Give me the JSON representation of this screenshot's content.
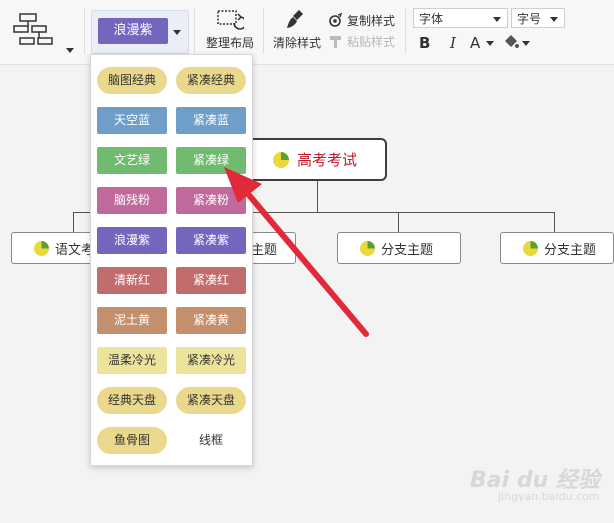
{
  "toolbar": {
    "theme_label": "浪漫紫",
    "tidy_layout": "整理布局",
    "clear_style": "清除样式",
    "copy_style": "复制样式",
    "paste_style": "粘贴样式",
    "font_placeholder": "字体",
    "size_placeholder": "字号",
    "bold": "B",
    "italic": "I",
    "font_color": "A"
  },
  "mindmap": {
    "root": "高考考试",
    "branches": [
      "语文考",
      "主题",
      "分支主题",
      "分支主题"
    ]
  },
  "theme_options": [
    {
      "label": "脑图经典",
      "bg": "#ead98c",
      "fg": "#333333",
      "pill": true
    },
    {
      "label": "紧凑经典",
      "bg": "#ead98c",
      "fg": "#333333",
      "pill": true
    },
    {
      "label": "天空蓝",
      "bg": "#6f9ec8",
      "fg": "#ffffff",
      "pill": false
    },
    {
      "label": "紧凑蓝",
      "bg": "#6f9ec8",
      "fg": "#ffffff",
      "pill": false
    },
    {
      "label": "文艺绿",
      "bg": "#70bb6f",
      "fg": "#ffffff",
      "pill": false
    },
    {
      "label": "紧凑绿",
      "bg": "#70bb6f",
      "fg": "#ffffff",
      "pill": false
    },
    {
      "label": "脑残粉",
      "bg": "#c06a9c",
      "fg": "#ffffff",
      "pill": false
    },
    {
      "label": "紧凑粉",
      "bg": "#c06a9c",
      "fg": "#ffffff",
      "pill": false
    },
    {
      "label": "浪漫紫",
      "bg": "#7466bd",
      "fg": "#ffffff",
      "pill": false
    },
    {
      "label": "紧凑紫",
      "bg": "#7466bd",
      "fg": "#ffffff",
      "pill": false
    },
    {
      "label": "清新红",
      "bg": "#c16d6d",
      "fg": "#ffffff",
      "pill": false
    },
    {
      "label": "紧凑红",
      "bg": "#c16d6d",
      "fg": "#ffffff",
      "pill": false
    },
    {
      "label": "泥土黄",
      "bg": "#c48f6c",
      "fg": "#ffffff",
      "pill": false
    },
    {
      "label": "紧凑黄",
      "bg": "#c48f6c",
      "fg": "#ffffff",
      "pill": false
    },
    {
      "label": "温柔冷光",
      "bg": "#ece49d",
      "fg": "#333333",
      "pill": false
    },
    {
      "label": "紧凑冷光",
      "bg": "#ece49d",
      "fg": "#333333",
      "pill": false
    },
    {
      "label": "经典天盘",
      "bg": "#ead98c",
      "fg": "#333333",
      "pill": true
    },
    {
      "label": "紧凑天盘",
      "bg": "#ead98c",
      "fg": "#333333",
      "pill": true
    },
    {
      "label": "鱼骨图",
      "bg": "#ead98c",
      "fg": "#333333",
      "pill": true
    },
    {
      "label": "线框",
      "bg": "#ffffff",
      "fg": "#333333",
      "pill": false
    }
  ],
  "watermark": {
    "main": "Bai du 经验",
    "sub": "jingyan.baidu.com"
  },
  "colors": {
    "accent_purple": "#7466bd",
    "root_text": "#c0182b",
    "arrow": "#e02a3a"
  }
}
